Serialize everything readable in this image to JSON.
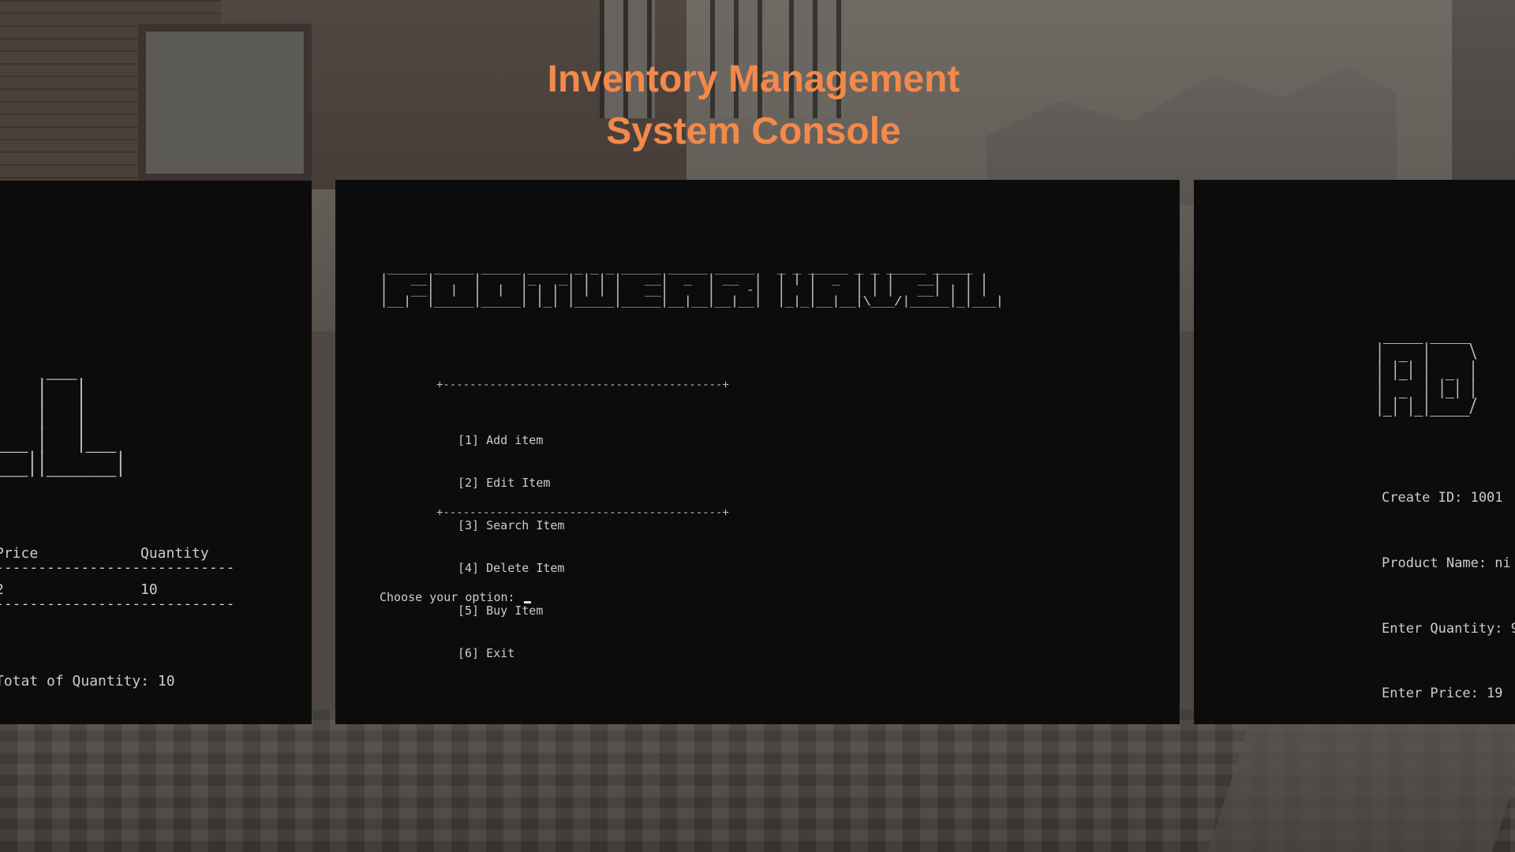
{
  "title": {
    "line1": "Inventory Management",
    "line2": "System Console"
  },
  "center_console": {
    "banner_name": "FOOTWEAR HAVEN",
    "border_line": "+------------------------------------------+",
    "menu_items": [
      "[1] Add item",
      "[2] Edit Item",
      "[3] Search Item",
      "[4] Delete Item",
      "[5] Buy Item",
      "[6] Exit"
    ],
    "prompt": "Choose your option: "
  },
  "left_console": {
    "banner_fragment": "LL",
    "col_price": "Price",
    "col_quantity": "Quantity",
    "rule": "----------------------------",
    "row_price": "2",
    "row_quantity": "10",
    "total_text": "Totat of Quantity: 10"
  },
  "right_console": {
    "banner_fragment": "AD",
    "create_id": "Create ID: 1001",
    "product_name": "Product Name: ni",
    "enter_quantity": "Enter Quantity: 9",
    "enter_price": "Enter Price: 19"
  },
  "colors": {
    "title": "#f3894a",
    "console_bg": "#0c0c0c",
    "console_text": "#cccccc"
  }
}
